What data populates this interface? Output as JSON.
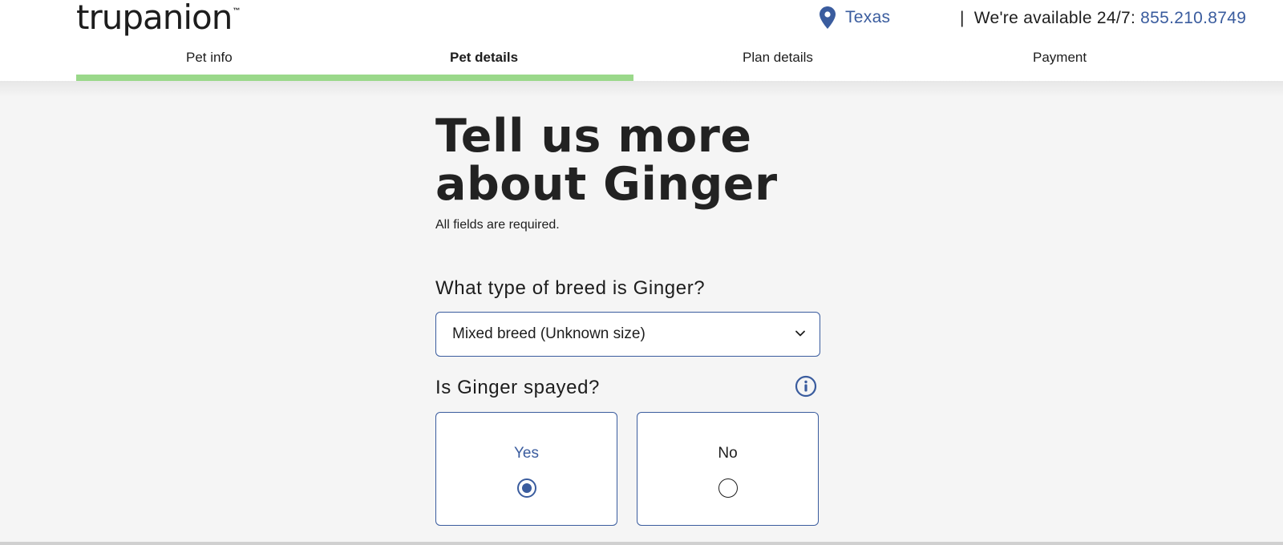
{
  "header": {
    "logo_text": "trupanion",
    "logo_tm": "™",
    "location": "Texas",
    "availability_separator": "|",
    "availability_label": "We're available 24/7:",
    "phone": "855.210.8749"
  },
  "steps": [
    {
      "label": "Pet info"
    },
    {
      "label": "Pet details"
    },
    {
      "label": "Plan details"
    },
    {
      "label": "Payment"
    }
  ],
  "progress": {
    "completed_fraction": 0.47
  },
  "main": {
    "title_line1": "Tell us more",
    "title_line2": "about Ginger",
    "subtitle": "All fields are required.",
    "breed_question": "What type of breed is Ginger?",
    "breed_value": "Mixed breed (Unknown size)",
    "spayed_question": "Is Ginger spayed?",
    "options": [
      {
        "label": "Yes",
        "selected": true
      },
      {
        "label": "No",
        "selected": false
      }
    ]
  },
  "colors": {
    "accent": "#3a5c9e",
    "progress": "#9ad88a",
    "background": "#f5f5f5"
  },
  "icons": [
    "location-pin-icon",
    "chevron-down-icon",
    "info-icon"
  ]
}
